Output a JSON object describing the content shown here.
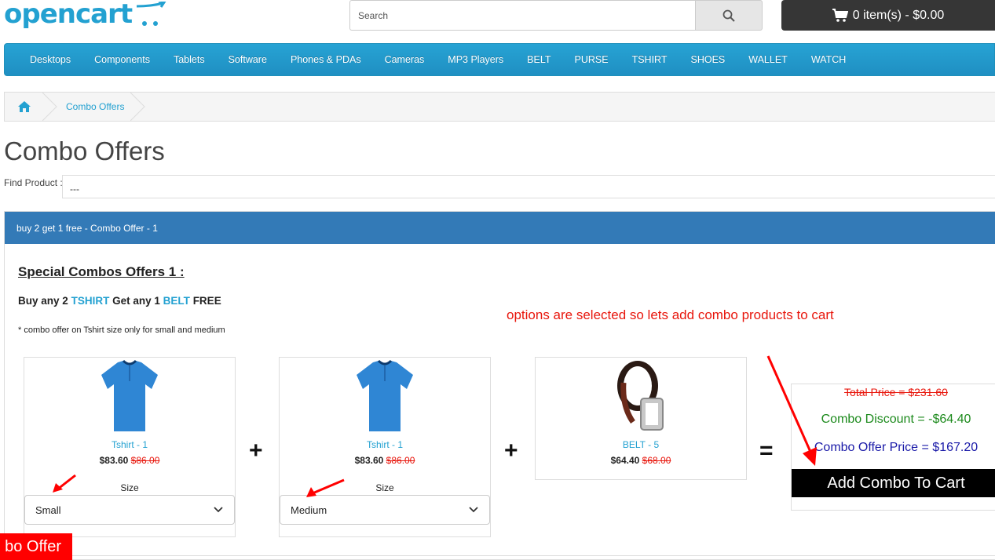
{
  "header": {
    "logo_text": "opencart",
    "search_placeholder": "Search",
    "cart_label": "0 item(s) - $0.00"
  },
  "menu": [
    "Desktops",
    "Components",
    "Tablets",
    "Software",
    "Phones & PDAs",
    "Cameras",
    "MP3 Players",
    "BELT",
    "PURSE",
    "TSHIRT",
    "SHOES",
    "WALLET",
    "WATCH"
  ],
  "breadcrumb": {
    "current": "Combo Offers"
  },
  "page": {
    "title": "Combo Offers",
    "find_label": "Find Product :",
    "find_value": "---"
  },
  "panel": {
    "heading": "buy 2 get 1 free - Combo Offer - 1",
    "combo_title": "Special Combos Offers 1 :",
    "sub_buy": "Buy any",
    "sub_qty1": "2",
    "sub_item1": "TSHIRT",
    "sub_get": "Get any",
    "sub_qty2": "1",
    "sub_item2": "BELT",
    "sub_free": "FREE",
    "note": "* combo offer on Tshirt size only for small and medium",
    "annotation": "options are selected so lets add combo products to cart"
  },
  "products": [
    {
      "name": "Tshirt - 1",
      "price": "$83.60",
      "old_price": "$86.00",
      "size_label": "Size",
      "size_value": "Small"
    },
    {
      "name": "Tshirt - 1",
      "price": "$83.60",
      "old_price": "$86.00",
      "size_label": "Size",
      "size_value": "Medium"
    },
    {
      "name": "BELT - 5",
      "price": "$64.40",
      "old_price": "$68.00"
    }
  ],
  "operators": {
    "plus": "+",
    "equals": "="
  },
  "summary": {
    "total": "Total Price = $231.60",
    "discount": "Combo Discount = -$64.40",
    "offer": "Combo Offer Price = $167.20",
    "button": "Add Combo To Cart"
  },
  "bottom_tab": "bo Offer",
  "colors": {
    "accent": "#23a1d1",
    "panel_head": "#337ab7",
    "red": "#e8160c",
    "green": "#1c8a1c",
    "navy": "#1a1aa8"
  }
}
